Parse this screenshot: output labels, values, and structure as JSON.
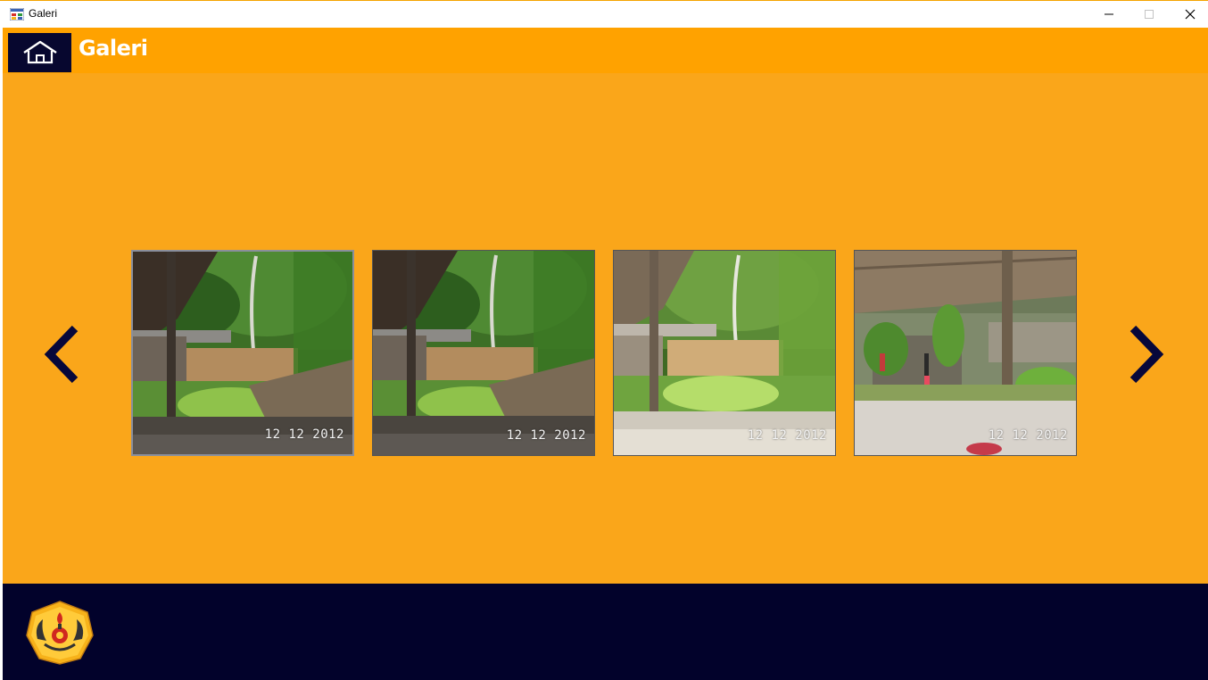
{
  "window": {
    "title": "Galeri",
    "minimize": "—",
    "maximize": "☐",
    "close": "✕"
  },
  "header": {
    "title": "Galeri"
  },
  "gallery": {
    "prev_icon": "chevron-left-icon",
    "next_icon": "chevron-right-icon",
    "images": [
      {
        "date": "12 12 2012",
        "scene": "pavilion-garden"
      },
      {
        "date": "12 12 2012",
        "scene": "pavilion-garden"
      },
      {
        "date": "12 12 2012",
        "scene": "pavilion-garden-bright"
      },
      {
        "date": "12 12 2012",
        "scene": "pavilion-people"
      }
    ]
  },
  "colors": {
    "header": "#ffa200",
    "content": "#faa61a",
    "navy": "#02022b",
    "home_button": "#07072f",
    "arrow": "#07073a"
  }
}
